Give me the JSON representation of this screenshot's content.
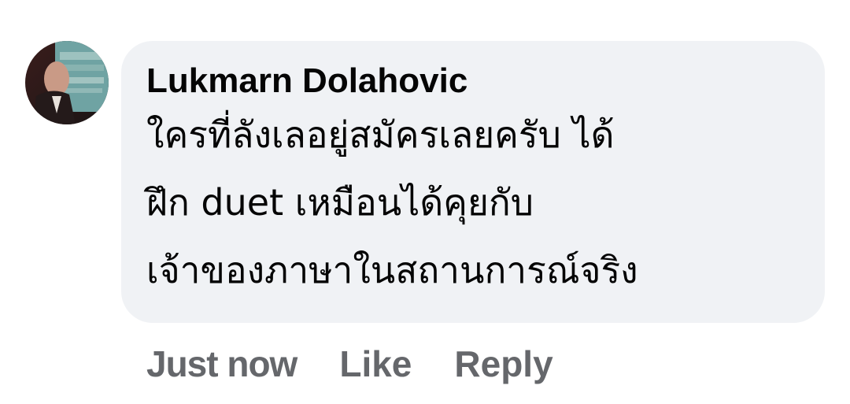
{
  "comment": {
    "author": "Lukmarn Dolahovic",
    "body_lines": [
      "ใครที่ลังเลอยู่สมัครเลยครับ ได้",
      "ฝึก duet เหมือนได้คุยกับ",
      "เจ้าของภาษาในสถานการณ์จริง"
    ],
    "timestamp": "Just now",
    "actions": {
      "like": "Like",
      "reply": "Reply"
    }
  },
  "colors": {
    "bubble_bg": "#f0f2f5",
    "text": "#050505",
    "meta_text": "#65676b"
  }
}
